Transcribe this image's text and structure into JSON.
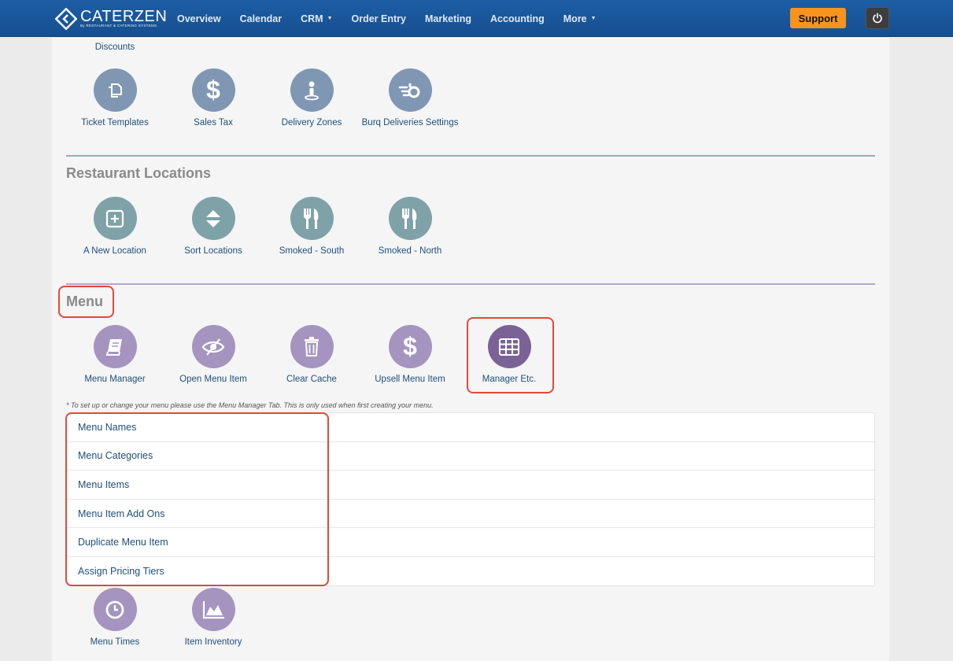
{
  "header": {
    "logo_name": "CATERZEN",
    "logo_sub": "By RESTAURANT & CATERING SYSTEMS",
    "nav": [
      {
        "label": "Overview"
      },
      {
        "label": "Calendar"
      },
      {
        "label": "CRM",
        "dropdown": true
      },
      {
        "label": "Order Entry"
      },
      {
        "label": "Marketing"
      },
      {
        "label": "Accounting"
      },
      {
        "label": "More",
        "dropdown": true
      }
    ],
    "support_label": "Support",
    "power_icon": "power-icon"
  },
  "settings": {
    "discounts_label": "Discounts",
    "tiles": [
      {
        "label": "Ticket Templates",
        "icon": "copy-icon"
      },
      {
        "label": "Sales Tax",
        "icon": "dollar-icon"
      },
      {
        "label": "Delivery Zones",
        "icon": "map-pin-icon"
      },
      {
        "label": "Burq Deliveries Settings",
        "icon": "fast-delivery-icon"
      }
    ]
  },
  "locations": {
    "title": "Restaurant Locations",
    "tiles": [
      {
        "label": "A New Location",
        "icon": "plus-square-icon"
      },
      {
        "label": "Sort Locations",
        "icon": "sort-icon"
      },
      {
        "label": "Smoked - South",
        "icon": "utensils-icon"
      },
      {
        "label": "Smoked - North",
        "icon": "utensils-icon"
      }
    ]
  },
  "menu": {
    "title": "Menu",
    "tiles": [
      {
        "label": "Menu Manager",
        "icon": "book-icon"
      },
      {
        "label": "Open Menu Item",
        "icon": "eye-slash-icon"
      },
      {
        "label": "Clear Cache",
        "icon": "trash-icon"
      },
      {
        "label": "Upsell Menu Item",
        "icon": "dollar-icon"
      },
      {
        "label": "Manager Etc.",
        "icon": "table-icon",
        "active": true
      }
    ],
    "note": "* To set up or change your menu please use the Menu Manager Tab. This is only used when first creating your menu.",
    "list": [
      "Menu Names",
      "Menu Categories",
      "Menu Items",
      "Menu Item Add Ons",
      "Duplicate Menu Item",
      "Assign Pricing Tiers"
    ],
    "more_tiles": [
      {
        "label": "Menu Times",
        "icon": "clock-icon"
      },
      {
        "label": "Item Inventory",
        "icon": "area-chart-icon"
      }
    ]
  },
  "colors": {
    "nav_bg": "#1d5ea5",
    "support": "#f7941d",
    "settings_circle": "#7f97b3",
    "locations_circle": "#7fa2a8",
    "menu_circle": "#a594bf",
    "menu_circle_active": "#7a6297",
    "highlight": "#e04a3a",
    "link": "#1f4e79"
  }
}
